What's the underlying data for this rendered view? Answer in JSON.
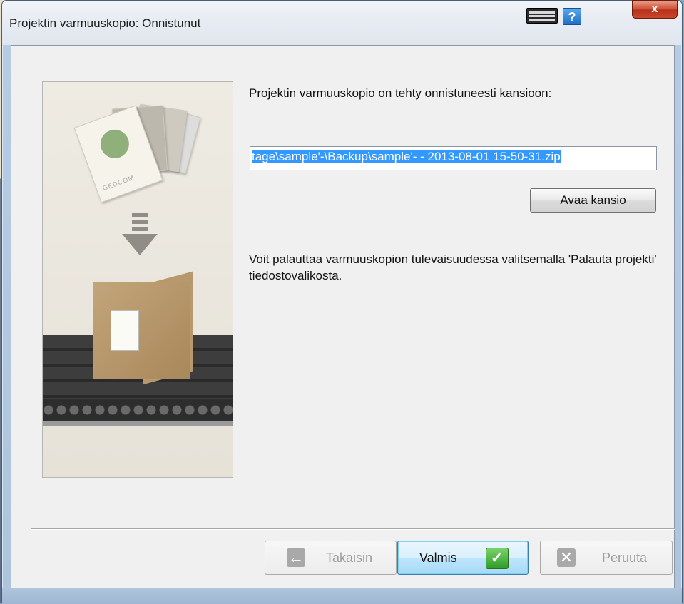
{
  "window": {
    "title": "Projektin varmuuskopio: Onnistunut",
    "close_glyph": "x",
    "help_glyph": "?"
  },
  "illustration": {
    "brand_text": "GEDCOM"
  },
  "content": {
    "success_message": "Projektin varmuuskopio on tehty onnistuneesti kansioon:",
    "backup_path": "tage\\sample'-\\Backup\\sample'- - 2013-08-01 15-50-31.zip",
    "open_folder_label": "Avaa kansio",
    "restore_hint": "Voit palauttaa varmuuskopion tulevaisuudessa valitsemalla 'Palauta projekti' tiedostovalikosta."
  },
  "footer": {
    "back_label": "Takaisin",
    "back_glyph": "←",
    "finish_label": "Valmis",
    "finish_glyph": "✓",
    "cancel_label": "Peruuta",
    "cancel_glyph": "✕"
  },
  "colors": {
    "selection": "#3399ff",
    "finish_accent": "#2e9d26",
    "close_button": "#c8472b"
  }
}
